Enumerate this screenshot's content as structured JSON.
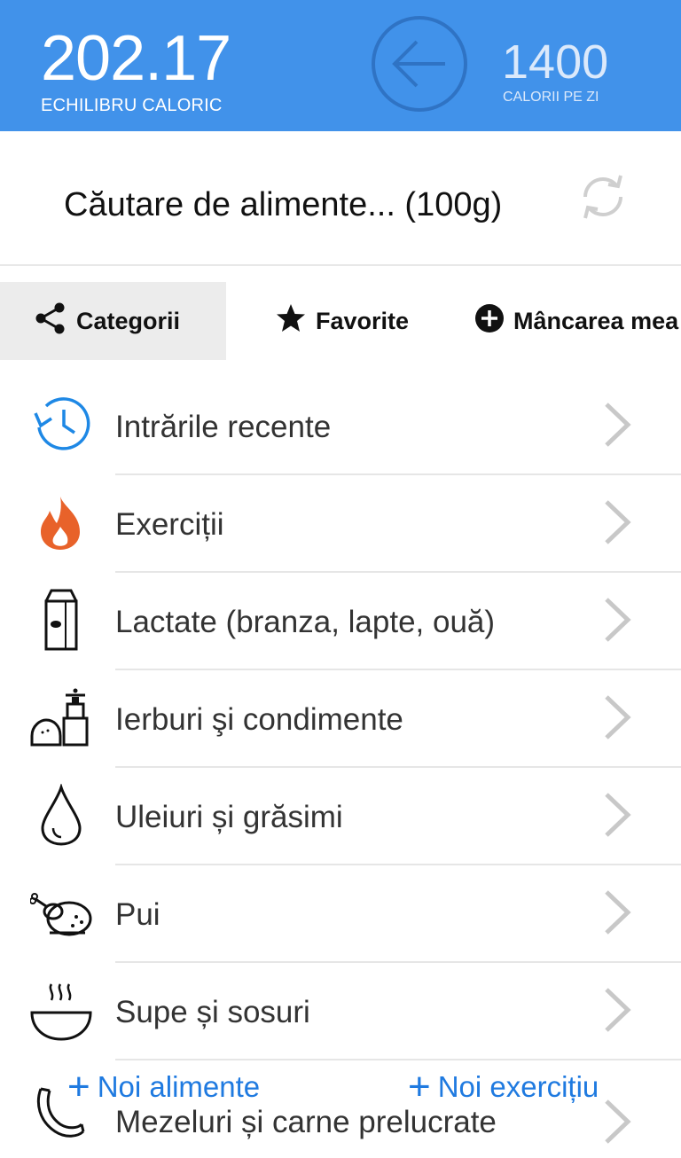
{
  "header": {
    "balance_value": "202.17",
    "balance_label": "ECHILIBRU CALORIC",
    "daily_value": "1400",
    "daily_label": "CALORII PE ZI",
    "back_icon": "back-arrow-circle-icon"
  },
  "search": {
    "title": "Căutare de alimente... (100g)",
    "refresh_icon": "refresh-icon"
  },
  "tabs": [
    {
      "label": "Categorii",
      "icon": "share-icon",
      "selected": true
    },
    {
      "label": "Favorite",
      "icon": "star-icon",
      "selected": false
    },
    {
      "label": "Mâncarea mea",
      "icon": "plus-circle-icon",
      "selected": false
    }
  ],
  "categories": [
    {
      "label": "Intrările recente",
      "icon": "recent-history-icon"
    },
    {
      "label": "Exerciții",
      "icon": "flame-icon"
    },
    {
      "label": "Lactate (branza, lapte, ouă)",
      "icon": "milk-carton-icon"
    },
    {
      "label": "Ierburi şi condimente",
      "icon": "salt-pepper-icon"
    },
    {
      "label": "Uleiuri și grăsimi",
      "icon": "oil-drop-icon"
    },
    {
      "label": "Pui",
      "icon": "roast-chicken-icon"
    },
    {
      "label": "Supe și sosuri",
      "icon": "soup-bowl-icon"
    },
    {
      "label": "Mezeluri și carne prelucrate",
      "icon": "sausage-icon"
    }
  ],
  "actions": {
    "add_food": "Noi alimente",
    "add_exercise": "Noi exercițiu"
  },
  "colors": {
    "header_bg": "#4192ea",
    "link": "#1f7ae0",
    "flame": "#e8622a"
  }
}
